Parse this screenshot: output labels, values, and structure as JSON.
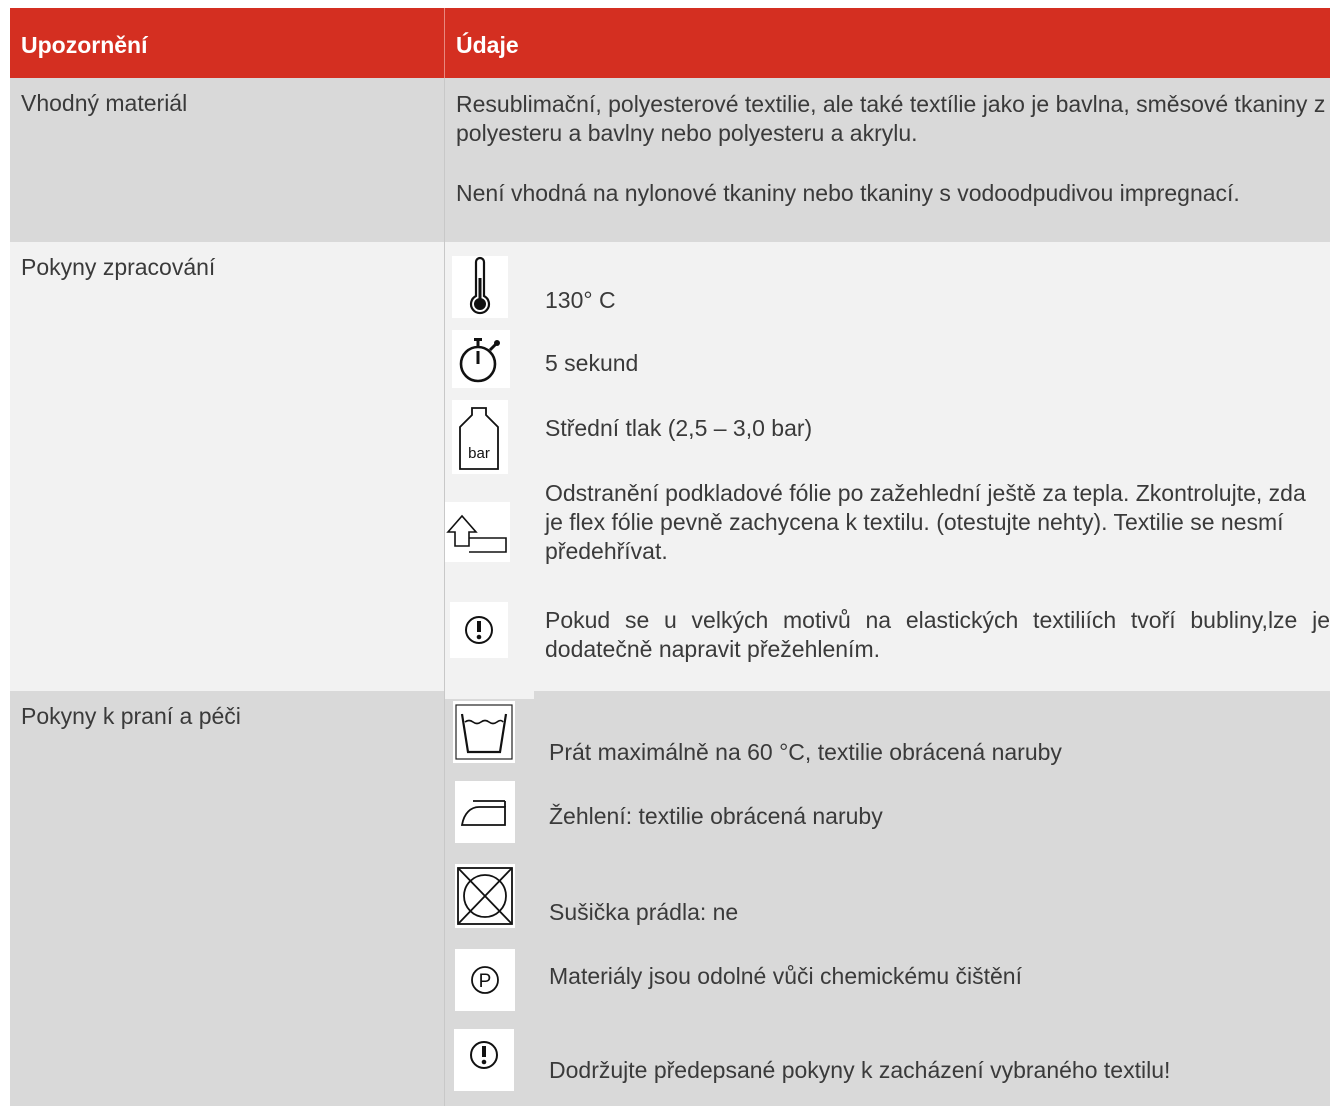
{
  "table": {
    "header": {
      "col1": "Upozornění",
      "col2": "Údaje"
    },
    "rows": [
      {
        "label": "Vhodný materiál",
        "paragraphs": [
          "Resublimační, polyesterové textilie, ale také textílie jako je bavlna, směsové tkaniny z polyesteru a bavlny nebo polyesteru a akrylu.",
          "Není vhodná na nylonové tkaniny nebo tkaniny s vodoodpudivou impregnací."
        ]
      },
      {
        "label": "Pokyny zpracování",
        "items": [
          {
            "icon": "thermometer-icon",
            "text": "130° C"
          },
          {
            "icon": "stopwatch-icon",
            "text": "5 sekund"
          },
          {
            "icon": "bar-weight-icon",
            "icon_text": "bar",
            "text": "Střední tlak (2,5 – 3,0 bar)"
          },
          {
            "icon": "peel-film-icon",
            "text": "Odstranění podkladové fólie po zažehlední ještě za tepla. Zkontrolujte, zda je flex fólie pevně zachycena k textilu. (otestujte nehty). Textilie se nesmí předehřívat."
          },
          {
            "icon": "warning-icon",
            "text": "Pokud se u velkých motivů na elastických textiliích tvoří bubliny,lze je dodatečně napravit přežehlením."
          }
        ]
      },
      {
        "label": "Pokyny k praní a péči",
        "items": [
          {
            "icon": "wash-tub-icon",
            "text": "Prát maximálně na 60 °C, textilie obrácená naruby"
          },
          {
            "icon": "iron-icon",
            "text": "Žehlení: textilie obrácená naruby"
          },
          {
            "icon": "no-tumble-dry-icon",
            "text": "Sušička prádla: ne"
          },
          {
            "icon": "dry-clean-p-icon",
            "icon_text": "P",
            "text": "Materiály jsou odolné vůči chemickému čištění"
          },
          {
            "icon": "warning-icon",
            "text": "Dodržujte předepsané pokyny k zacházení vybraného textilu!"
          }
        ]
      }
    ]
  }
}
